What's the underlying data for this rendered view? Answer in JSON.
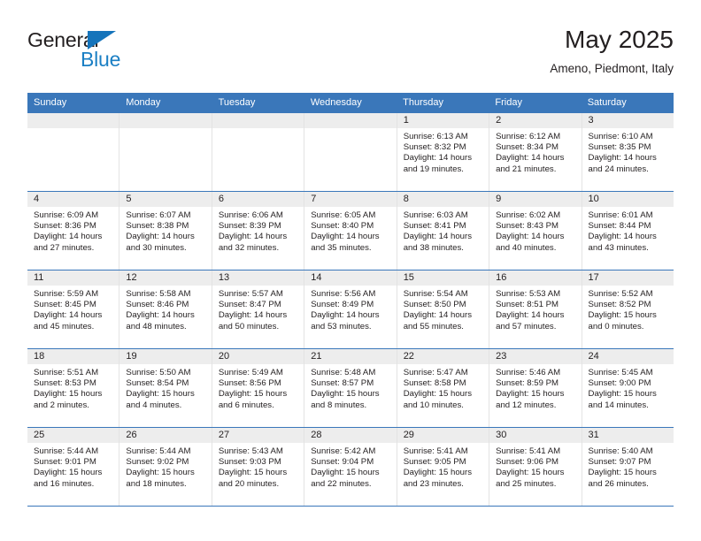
{
  "brand": {
    "name_top": "General",
    "name_bottom": "Blue",
    "triangle_color": "#1574bb",
    "blue_text_color": "#1b7fc4"
  },
  "header": {
    "title": "May 2025",
    "subtitle": "Ameno, Piedmont, Italy"
  },
  "theme": {
    "header_blue": "#3a77ba",
    "daynum_band": "#ededed",
    "text": "#231f20"
  },
  "weekdays": [
    "Sunday",
    "Monday",
    "Tuesday",
    "Wednesday",
    "Thursday",
    "Friday",
    "Saturday"
  ],
  "weeks": [
    [
      {
        "day": "",
        "empty": true
      },
      {
        "day": "",
        "empty": true
      },
      {
        "day": "",
        "empty": true
      },
      {
        "day": "",
        "empty": true
      },
      {
        "day": "1",
        "sunrise": "Sunrise: 6:13 AM",
        "sunset": "Sunset: 8:32 PM",
        "daylight1": "Daylight: 14 hours",
        "daylight2": "and 19 minutes."
      },
      {
        "day": "2",
        "sunrise": "Sunrise: 6:12 AM",
        "sunset": "Sunset: 8:34 PM",
        "daylight1": "Daylight: 14 hours",
        "daylight2": "and 21 minutes."
      },
      {
        "day": "3",
        "sunrise": "Sunrise: 6:10 AM",
        "sunset": "Sunset: 8:35 PM",
        "daylight1": "Daylight: 14 hours",
        "daylight2": "and 24 minutes."
      }
    ],
    [
      {
        "day": "4",
        "sunrise": "Sunrise: 6:09 AM",
        "sunset": "Sunset: 8:36 PM",
        "daylight1": "Daylight: 14 hours",
        "daylight2": "and 27 minutes."
      },
      {
        "day": "5",
        "sunrise": "Sunrise: 6:07 AM",
        "sunset": "Sunset: 8:38 PM",
        "daylight1": "Daylight: 14 hours",
        "daylight2": "and 30 minutes."
      },
      {
        "day": "6",
        "sunrise": "Sunrise: 6:06 AM",
        "sunset": "Sunset: 8:39 PM",
        "daylight1": "Daylight: 14 hours",
        "daylight2": "and 32 minutes."
      },
      {
        "day": "7",
        "sunrise": "Sunrise: 6:05 AM",
        "sunset": "Sunset: 8:40 PM",
        "daylight1": "Daylight: 14 hours",
        "daylight2": "and 35 minutes."
      },
      {
        "day": "8",
        "sunrise": "Sunrise: 6:03 AM",
        "sunset": "Sunset: 8:41 PM",
        "daylight1": "Daylight: 14 hours",
        "daylight2": "and 38 minutes."
      },
      {
        "day": "9",
        "sunrise": "Sunrise: 6:02 AM",
        "sunset": "Sunset: 8:43 PM",
        "daylight1": "Daylight: 14 hours",
        "daylight2": "and 40 minutes."
      },
      {
        "day": "10",
        "sunrise": "Sunrise: 6:01 AM",
        "sunset": "Sunset: 8:44 PM",
        "daylight1": "Daylight: 14 hours",
        "daylight2": "and 43 minutes."
      }
    ],
    [
      {
        "day": "11",
        "sunrise": "Sunrise: 5:59 AM",
        "sunset": "Sunset: 8:45 PM",
        "daylight1": "Daylight: 14 hours",
        "daylight2": "and 45 minutes."
      },
      {
        "day": "12",
        "sunrise": "Sunrise: 5:58 AM",
        "sunset": "Sunset: 8:46 PM",
        "daylight1": "Daylight: 14 hours",
        "daylight2": "and 48 minutes."
      },
      {
        "day": "13",
        "sunrise": "Sunrise: 5:57 AM",
        "sunset": "Sunset: 8:47 PM",
        "daylight1": "Daylight: 14 hours",
        "daylight2": "and 50 minutes."
      },
      {
        "day": "14",
        "sunrise": "Sunrise: 5:56 AM",
        "sunset": "Sunset: 8:49 PM",
        "daylight1": "Daylight: 14 hours",
        "daylight2": "and 53 minutes."
      },
      {
        "day": "15",
        "sunrise": "Sunrise: 5:54 AM",
        "sunset": "Sunset: 8:50 PM",
        "daylight1": "Daylight: 14 hours",
        "daylight2": "and 55 minutes."
      },
      {
        "day": "16",
        "sunrise": "Sunrise: 5:53 AM",
        "sunset": "Sunset: 8:51 PM",
        "daylight1": "Daylight: 14 hours",
        "daylight2": "and 57 minutes."
      },
      {
        "day": "17",
        "sunrise": "Sunrise: 5:52 AM",
        "sunset": "Sunset: 8:52 PM",
        "daylight1": "Daylight: 15 hours",
        "daylight2": "and 0 minutes."
      }
    ],
    [
      {
        "day": "18",
        "sunrise": "Sunrise: 5:51 AM",
        "sunset": "Sunset: 8:53 PM",
        "daylight1": "Daylight: 15 hours",
        "daylight2": "and 2 minutes."
      },
      {
        "day": "19",
        "sunrise": "Sunrise: 5:50 AM",
        "sunset": "Sunset: 8:54 PM",
        "daylight1": "Daylight: 15 hours",
        "daylight2": "and 4 minutes."
      },
      {
        "day": "20",
        "sunrise": "Sunrise: 5:49 AM",
        "sunset": "Sunset: 8:56 PM",
        "daylight1": "Daylight: 15 hours",
        "daylight2": "and 6 minutes."
      },
      {
        "day": "21",
        "sunrise": "Sunrise: 5:48 AM",
        "sunset": "Sunset: 8:57 PM",
        "daylight1": "Daylight: 15 hours",
        "daylight2": "and 8 minutes."
      },
      {
        "day": "22",
        "sunrise": "Sunrise: 5:47 AM",
        "sunset": "Sunset: 8:58 PM",
        "daylight1": "Daylight: 15 hours",
        "daylight2": "and 10 minutes."
      },
      {
        "day": "23",
        "sunrise": "Sunrise: 5:46 AM",
        "sunset": "Sunset: 8:59 PM",
        "daylight1": "Daylight: 15 hours",
        "daylight2": "and 12 minutes."
      },
      {
        "day": "24",
        "sunrise": "Sunrise: 5:45 AM",
        "sunset": "Sunset: 9:00 PM",
        "daylight1": "Daylight: 15 hours",
        "daylight2": "and 14 minutes."
      }
    ],
    [
      {
        "day": "25",
        "sunrise": "Sunrise: 5:44 AM",
        "sunset": "Sunset: 9:01 PM",
        "daylight1": "Daylight: 15 hours",
        "daylight2": "and 16 minutes."
      },
      {
        "day": "26",
        "sunrise": "Sunrise: 5:44 AM",
        "sunset": "Sunset: 9:02 PM",
        "daylight1": "Daylight: 15 hours",
        "daylight2": "and 18 minutes."
      },
      {
        "day": "27",
        "sunrise": "Sunrise: 5:43 AM",
        "sunset": "Sunset: 9:03 PM",
        "daylight1": "Daylight: 15 hours",
        "daylight2": "and 20 minutes."
      },
      {
        "day": "28",
        "sunrise": "Sunrise: 5:42 AM",
        "sunset": "Sunset: 9:04 PM",
        "daylight1": "Daylight: 15 hours",
        "daylight2": "and 22 minutes."
      },
      {
        "day": "29",
        "sunrise": "Sunrise: 5:41 AM",
        "sunset": "Sunset: 9:05 PM",
        "daylight1": "Daylight: 15 hours",
        "daylight2": "and 23 minutes."
      },
      {
        "day": "30",
        "sunrise": "Sunrise: 5:41 AM",
        "sunset": "Sunset: 9:06 PM",
        "daylight1": "Daylight: 15 hours",
        "daylight2": "and 25 minutes."
      },
      {
        "day": "31",
        "sunrise": "Sunrise: 5:40 AM",
        "sunset": "Sunset: 9:07 PM",
        "daylight1": "Daylight: 15 hours",
        "daylight2": "and 26 minutes."
      }
    ]
  ]
}
